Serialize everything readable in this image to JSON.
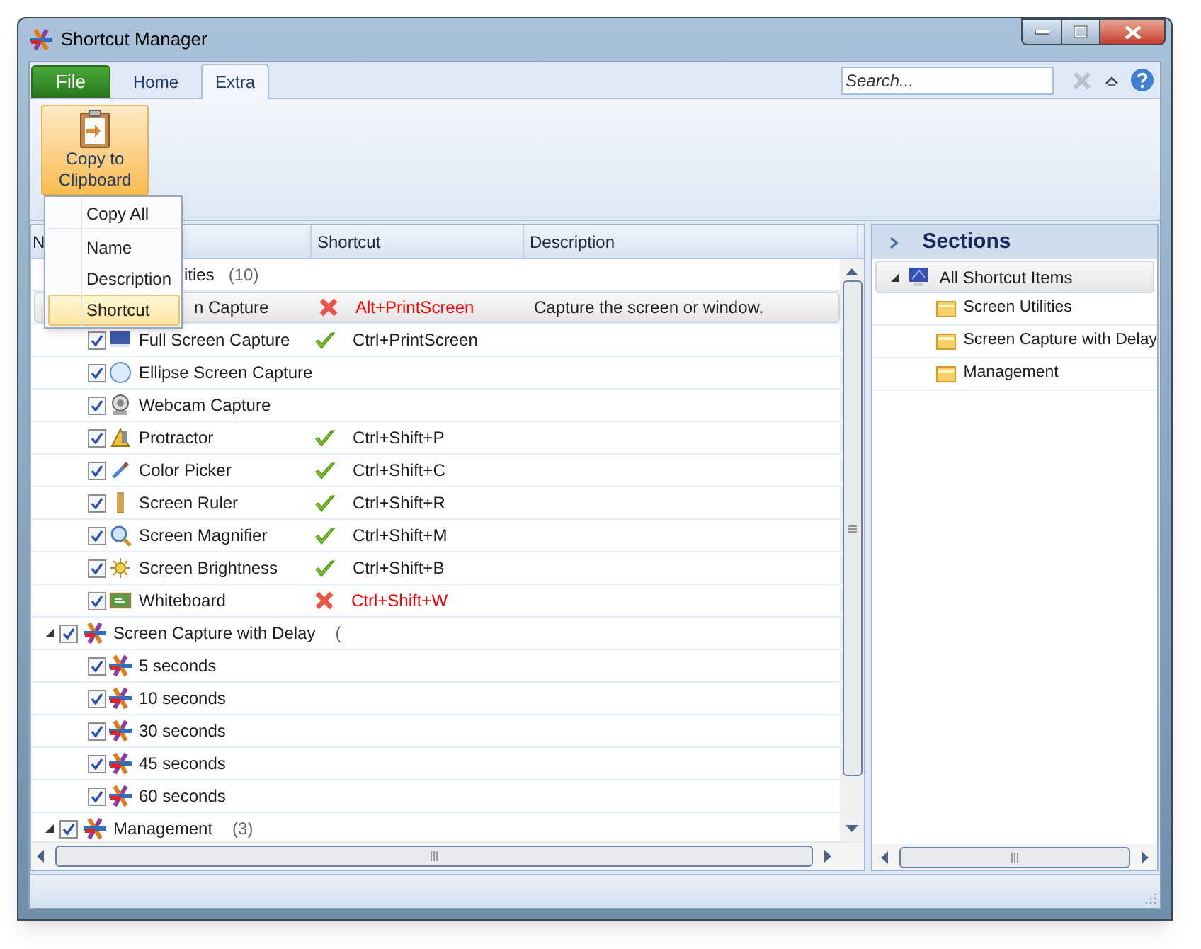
{
  "window": {
    "title": "Shortcut Manager"
  },
  "ribbon_tabs": [
    {
      "label": "File",
      "kind": "file",
      "selected": false
    },
    {
      "label": "Home",
      "kind": "tab",
      "selected": false
    },
    {
      "label": "Extra",
      "kind": "tab",
      "selected": true
    }
  ],
  "search": {
    "placeholder": "Search..."
  },
  "ribbon": {
    "button": {
      "label": "Copy to Clipboard"
    }
  },
  "dropdown_menu": {
    "items": [
      {
        "label": "Copy All",
        "selected": false,
        "separator_after": true
      },
      {
        "label": "Name",
        "selected": false,
        "separator_after": false
      },
      {
        "label": "Description",
        "selected": false,
        "separator_after": false
      },
      {
        "label": "Shortcut",
        "selected": true,
        "separator_after": false
      }
    ]
  },
  "grid": {
    "columns": [
      "N",
      "Shortcut",
      "Description"
    ],
    "rows": [
      {
        "kind": "group",
        "label": "ities",
        "count": "(10)",
        "selected": false
      },
      {
        "kind": "item",
        "label": "n Capture",
        "conflict": true,
        "shortcut": "Alt+PrintScreen",
        "description": "Capture the screen or window.",
        "selected": true
      },
      {
        "kind": "item",
        "label": "Full Screen Capture",
        "checked": true,
        "conflict": false,
        "shortcut": "Ctrl+PrintScreen",
        "selected": false
      },
      {
        "kind": "item",
        "label": "Ellipse Screen Capture",
        "checked": true,
        "selected": false
      },
      {
        "kind": "item",
        "label": "Webcam Capture",
        "checked": true,
        "selected": false
      },
      {
        "kind": "item",
        "label": "Protractor",
        "checked": true,
        "conflict": false,
        "shortcut": "Ctrl+Shift+P",
        "selected": false
      },
      {
        "kind": "item",
        "label": "Color Picker",
        "checked": true,
        "conflict": false,
        "shortcut": "Ctrl+Shift+C",
        "selected": false
      },
      {
        "kind": "item",
        "label": "Screen Ruler",
        "checked": true,
        "conflict": false,
        "shortcut": "Ctrl+Shift+R",
        "selected": false
      },
      {
        "kind": "item",
        "label": "Screen Magnifier",
        "checked": true,
        "conflict": false,
        "shortcut": "Ctrl+Shift+M",
        "selected": false
      },
      {
        "kind": "item",
        "label": "Screen Brightness",
        "checked": true,
        "conflict": false,
        "shortcut": "Ctrl+Shift+B",
        "selected": false
      },
      {
        "kind": "item",
        "label": "Whiteboard",
        "checked": true,
        "conflict": true,
        "shortcut": "Ctrl+Shift+W",
        "selected": false
      },
      {
        "kind": "group",
        "label": "Screen Capture with Delay",
        "count": "(",
        "expanded": true,
        "checked": true,
        "selected": false
      },
      {
        "kind": "item",
        "label": "5 seconds",
        "checked": true,
        "selected": false
      },
      {
        "kind": "item",
        "label": "10 seconds",
        "checked": true,
        "selected": false
      },
      {
        "kind": "item",
        "label": "30 seconds",
        "checked": true,
        "selected": false
      },
      {
        "kind": "item",
        "label": "45 seconds",
        "checked": true,
        "selected": false
      },
      {
        "kind": "item",
        "label": "60 seconds",
        "checked": true,
        "selected": false
      },
      {
        "kind": "group",
        "label": "Management",
        "count": "(3)",
        "expanded": true,
        "checked": true,
        "selected": false
      }
    ]
  },
  "sections": {
    "title": "Sections",
    "items": [
      {
        "label": "All Shortcut Items",
        "expanded": true,
        "selected": true,
        "children": [
          {
            "label": "Screen Utilities",
            "selected": false
          },
          {
            "label": "Screen Capture with Delay",
            "selected": false
          },
          {
            "label": "Management",
            "selected": false
          }
        ]
      }
    ]
  }
}
